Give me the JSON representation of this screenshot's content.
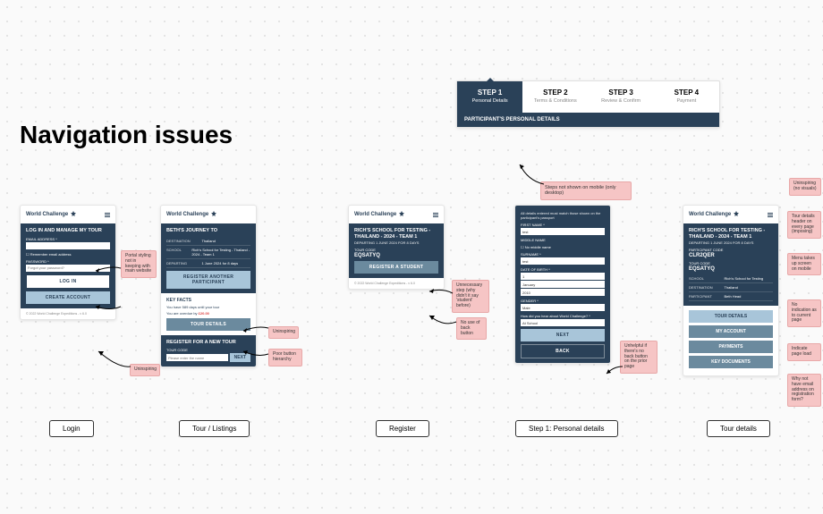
{
  "title": "Navigation issues",
  "brand": "World Challenge",
  "login": {
    "header": "LOG IN AND MANAGE MY TOUR",
    "email_lbl": "EMAIL ADDRESS *",
    "remember": "Remember email address",
    "pass_lbl": "PASSWORD *",
    "pass_ph": "Forgot your password?",
    "login_btn": "LOG IN",
    "create_btn": "CREATE ACCOUNT",
    "footer": "© 2022 World Challenge Expeditions - v 6.0"
  },
  "tour": {
    "header": "BETH'S JOURNEY TO",
    "dest_lbl": "DESTINATION",
    "dest": "Thailand",
    "school_lbl": "SCHOOL",
    "school": "Rich's School for Testing - Thailand - 2024 - Team 1",
    "depart_lbl": "DEPARTING",
    "depart": "1 June 2024 for 8 days",
    "reg_btn": "REGISTER ANOTHER PARTICIPANT",
    "kf_title": "KEY FACTS",
    "kf1": "You have 589 days until your tour",
    "kf2_a": "You are overdue by ",
    "kf2_b": "£20.00",
    "details_btn": "TOUR DETAILS",
    "newtour": "REGISTER FOR A NEW TOUR",
    "tourcode_lbl": "TOUR CODE",
    "tourcode_ph": "Please enter the name",
    "next_btn": "NEXT"
  },
  "register": {
    "header": "RICH'S SCHOOL FOR TESTING - THAILAND - 2024 - TEAM 1",
    "sub": "DEPARTING 1 JUNE 2024 FOR 8 DAYS",
    "code_lbl": "TOUR CODE",
    "code": "EQSATYQ",
    "btn": "REGISTER A STUDENT",
    "footer": "© 2022 World Challenge Expeditions - v 6.0"
  },
  "personal": {
    "intro": "All details entered must match those shown on the participant's passport",
    "fname_lbl": "FIRST NAME *",
    "fname": "test",
    "mname_lbl": "MIDDLE NAME",
    "mname_chk": "No middle name",
    "lname_lbl": "SURNAME *",
    "lname": "test",
    "dob_lbl": "DATE OF BIRTH *",
    "dob_d": "1",
    "dob_m": "January",
    "dob_y": "2010",
    "gender_lbl": "GENDER *",
    "gender": "Male",
    "hear_lbl": "How did you hear about World Challenge? *",
    "hear": "At School",
    "next": "NEXT",
    "back": "BACK"
  },
  "details": {
    "header": "RICH'S SCHOOL FOR TESTING - THAILAND - 2024 - TEAM 1",
    "sub": "DEPARTING 1 JUNE 2024 FOR 8 DAYS",
    "pcode_lbl": "PARTICIPANT CODE",
    "pcode": "CLR2QER",
    "tcode_lbl": "TOUR CODE",
    "tcode": "EQSATYQ",
    "school_lbl": "SCHOOL",
    "school": "Rich's School for Testing",
    "dest_lbl": "DESTINATION",
    "dest": "Thailand",
    "part_lbl": "PARTICIPANT",
    "part_text": "Beth Head",
    "nav1": "TOUR DETAILS",
    "nav2": "MY ACCOUNT",
    "nav3": "PAYMENTS",
    "nav4": "KEY DOCUMENTS"
  },
  "steps": {
    "s1t": "STEP 1",
    "s1s": "Personal Details",
    "s2t": "STEP 2",
    "s2s": "Terms & Conditions",
    "s3t": "STEP 3",
    "s3s": "Review & Confirm",
    "s4t": "STEP 4",
    "s4s": "Payment",
    "bar": "PARTICIPANT'S PERSONAL DETAILS"
  },
  "notes": {
    "n1": "Portal styling not in keeping with main website",
    "n2": "Uninspiring",
    "n3": "Uninspiring",
    "n4": "Poor button hierarchy",
    "n5": "Steps not shown on mobile (only desktop)",
    "n6": "Unnecessary step (why didn't it say 'student' before)",
    "n7": "No use of back button",
    "n8": "Unhelpful if there's no back button on the prior page",
    "n9": "Uninspiring (no visuals)",
    "n10": "Tour details header on every page (imposing)",
    "n11": "Menu takes up screen on mobile",
    "n12": "No indication as to current page",
    "n13": "Indicate page load",
    "n14": "Why not have email address on registration form?"
  },
  "captions": {
    "c1": "Login",
    "c2": "Tour / Listings",
    "c3": "Register",
    "c4": "Step 1: Personal details",
    "c5": "Tour details"
  }
}
